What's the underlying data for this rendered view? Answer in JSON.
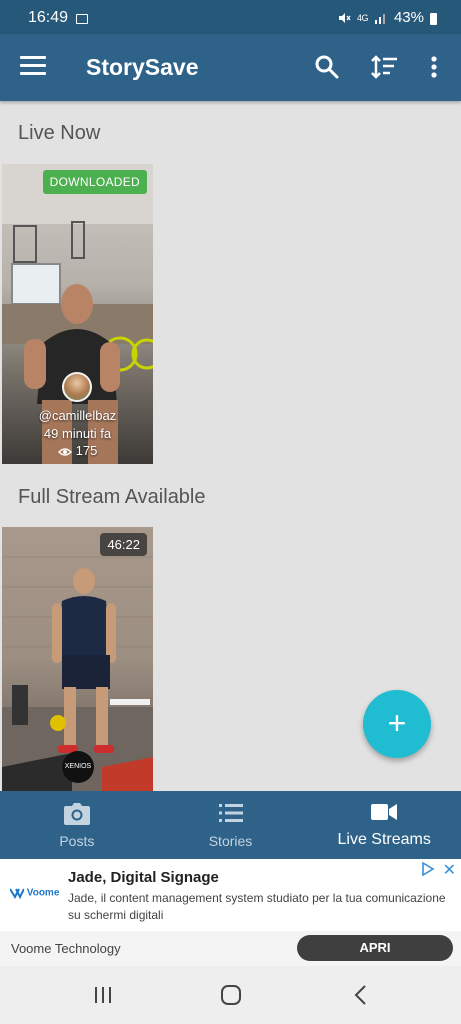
{
  "status_bar": {
    "time": "16:49",
    "battery": "43%",
    "network": "4G"
  },
  "app_bar": {
    "title": "StorySave"
  },
  "sections": {
    "live_now": "Live Now",
    "full_stream": "Full Stream Available"
  },
  "live_item": {
    "badge": "DOWNLOADED",
    "username": "@camillelbaz",
    "time_ago": "49 minuti fa",
    "views": "175"
  },
  "full_item": {
    "duration": "46:22",
    "brand": "XENIOS"
  },
  "fab": {
    "icon": "plus-icon"
  },
  "bottom_nav": {
    "items": [
      {
        "label": "Posts",
        "icon": "camera-icon"
      },
      {
        "label": "Stories",
        "icon": "list-icon"
      },
      {
        "label": "Live Streams",
        "icon": "video-camera-icon",
        "active": true
      }
    ]
  },
  "ad": {
    "logo": "Voome",
    "title": "Jade, Digital Signage",
    "description": "Jade, il content management system studiato per la tua comunicazione su schermi digitali",
    "company": "Voome Technology",
    "cta": "APRI"
  },
  "colors": {
    "app_bar": "#2e6289",
    "status_bar": "#255879",
    "fab": "#1fbcd2",
    "badge_downloaded": "#4caf50",
    "background": "#e2e2e2"
  }
}
